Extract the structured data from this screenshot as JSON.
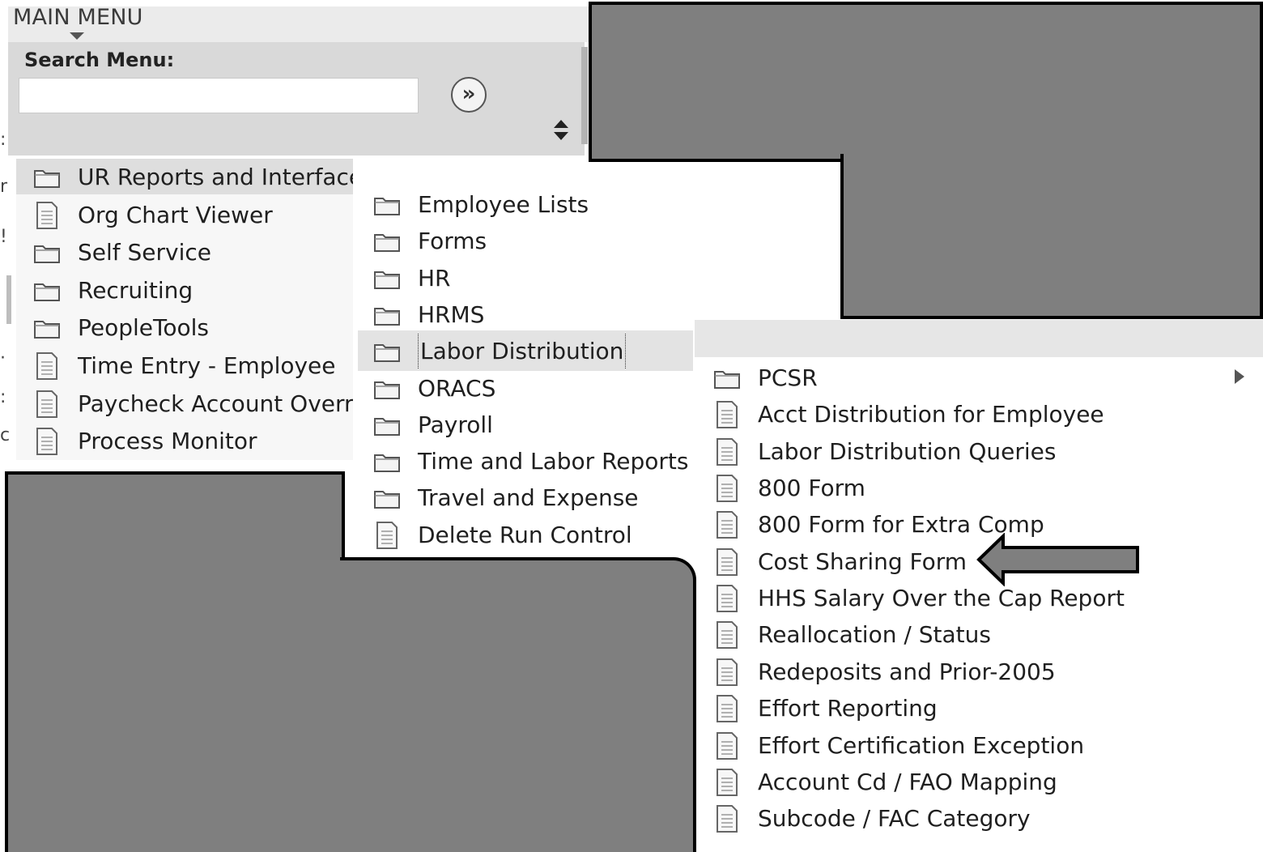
{
  "header": {
    "title": "MAIN MENU"
  },
  "search": {
    "label": "Search Menu:",
    "value": "",
    "placeholder": "",
    "go_icon": "double-chevron-right-icon",
    "go_glyph": "»"
  },
  "menu_level1": {
    "items": [
      {
        "label": "UR Reports and Interfaces",
        "icon": "folder-icon"
      },
      {
        "label": "Org Chart Viewer",
        "icon": "document-icon"
      },
      {
        "label": "Self Service",
        "icon": "folder-icon"
      },
      {
        "label": "Recruiting",
        "icon": "folder-icon"
      },
      {
        "label": "PeopleTools",
        "icon": "folder-icon"
      },
      {
        "label": "Time Entry - Employee",
        "icon": "document-icon"
      },
      {
        "label": "Paycheck Account Overrid",
        "icon": "document-icon"
      },
      {
        "label": "Process Monitor",
        "icon": "document-icon"
      }
    ]
  },
  "menu_level2": {
    "items": [
      {
        "label": "Employee Lists",
        "icon": "folder-icon"
      },
      {
        "label": "Forms",
        "icon": "folder-icon"
      },
      {
        "label": "HR",
        "icon": "folder-icon"
      },
      {
        "label": "HRMS",
        "icon": "folder-icon"
      },
      {
        "label": "Labor Distribution",
        "icon": "folder-icon",
        "selected": true
      },
      {
        "label": "ORACS",
        "icon": "folder-icon"
      },
      {
        "label": "Payroll",
        "icon": "folder-icon"
      },
      {
        "label": "Time and Labor Reports",
        "icon": "folder-icon"
      },
      {
        "label": "Travel and Expense",
        "icon": "folder-icon"
      },
      {
        "label": "Delete Run Control",
        "icon": "document-icon"
      }
    ]
  },
  "menu_level3": {
    "items": [
      {
        "label": "PCSR",
        "icon": "folder-icon",
        "has_submenu": true
      },
      {
        "label": "Acct Distribution for Employee",
        "icon": "document-icon"
      },
      {
        "label": "Labor Distribution Queries",
        "icon": "document-icon"
      },
      {
        "label": "800 Form",
        "icon": "document-icon"
      },
      {
        "label": "800 Form for Extra Comp",
        "icon": "document-icon"
      },
      {
        "label": "Cost Sharing Form",
        "icon": "document-icon",
        "highlighted_by_arrow": true
      },
      {
        "label": "HHS Salary Over the Cap Report",
        "icon": "document-icon"
      },
      {
        "label": "Reallocation / Status",
        "icon": "document-icon"
      },
      {
        "label": "Redeposits and Prior-2005",
        "icon": "document-icon"
      },
      {
        "label": "Effort Reporting",
        "icon": "document-icon"
      },
      {
        "label": "Effort Certification Exception",
        "icon": "document-icon"
      },
      {
        "label": "Account Cd / FAO Mapping",
        "icon": "document-icon"
      },
      {
        "label": "Subcode / FAC Category",
        "icon": "document-icon"
      }
    ]
  },
  "colors": {
    "redaction": "#7f7f7f",
    "selected_row": "#e3e3e3",
    "menu_header": "#dedede"
  }
}
